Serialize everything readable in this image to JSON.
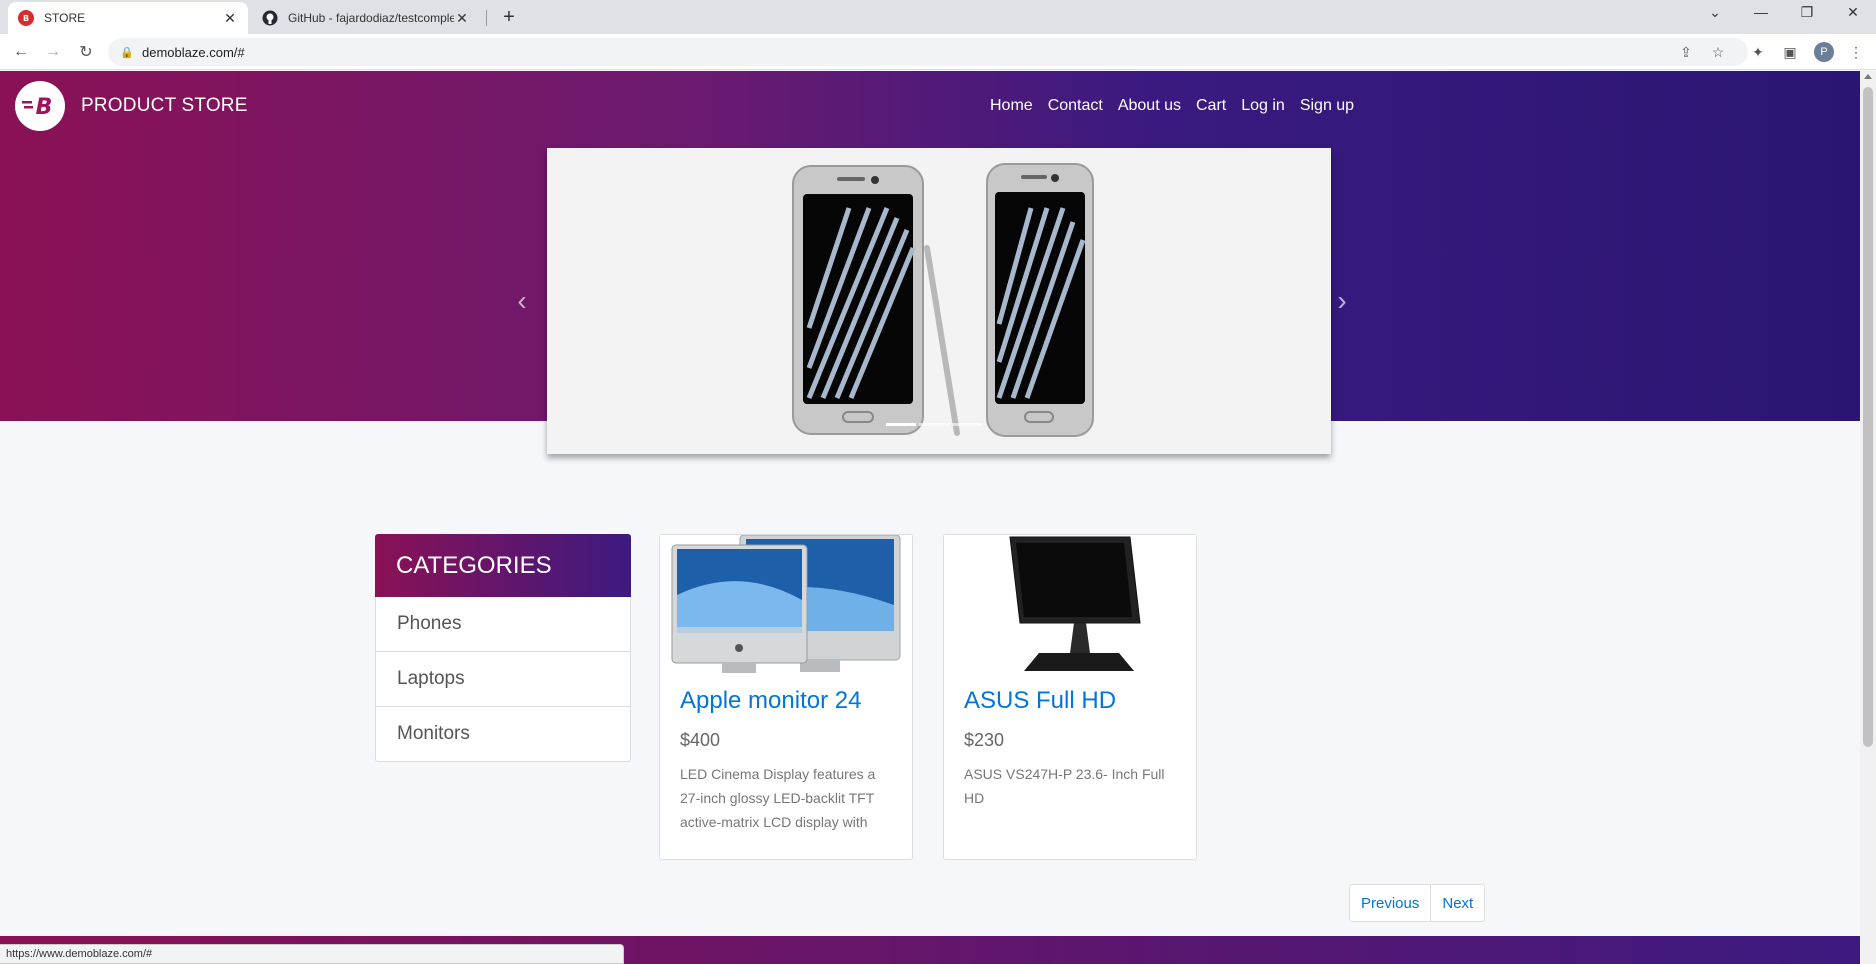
{
  "browser": {
    "tabs": [
      {
        "title": "STORE",
        "active": true
      },
      {
        "title": "GitHub - fajardodiaz/testcomplet",
        "active": false
      }
    ],
    "url": "demoblaze.com/#",
    "avatar_letter": "P",
    "status_url": "https://www.demoblaze.com/#"
  },
  "site": {
    "brand": "PRODUCT STORE",
    "nav": [
      "Home",
      "Contact",
      "About us",
      "Cart",
      "Log in",
      "Sign up"
    ]
  },
  "categories": {
    "heading": "CATEGORIES",
    "items": [
      "Phones",
      "Laptops",
      "Monitors"
    ]
  },
  "products": [
    {
      "title": "Apple monitor 24",
      "price": "$400",
      "description": "LED Cinema Display features a 27-inch glossy LED-backlit TFT active-matrix LCD display with"
    },
    {
      "title": "ASUS Full HD",
      "price": "$230",
      "description": "ASUS VS247H-P 23.6- Inch Full HD"
    }
  ],
  "pagination": {
    "previous": "Previous",
    "next": "Next"
  },
  "colors": {
    "link": "#0275d8",
    "gradient_start": "#8a1155",
    "gradient_end": "#2a1672"
  }
}
